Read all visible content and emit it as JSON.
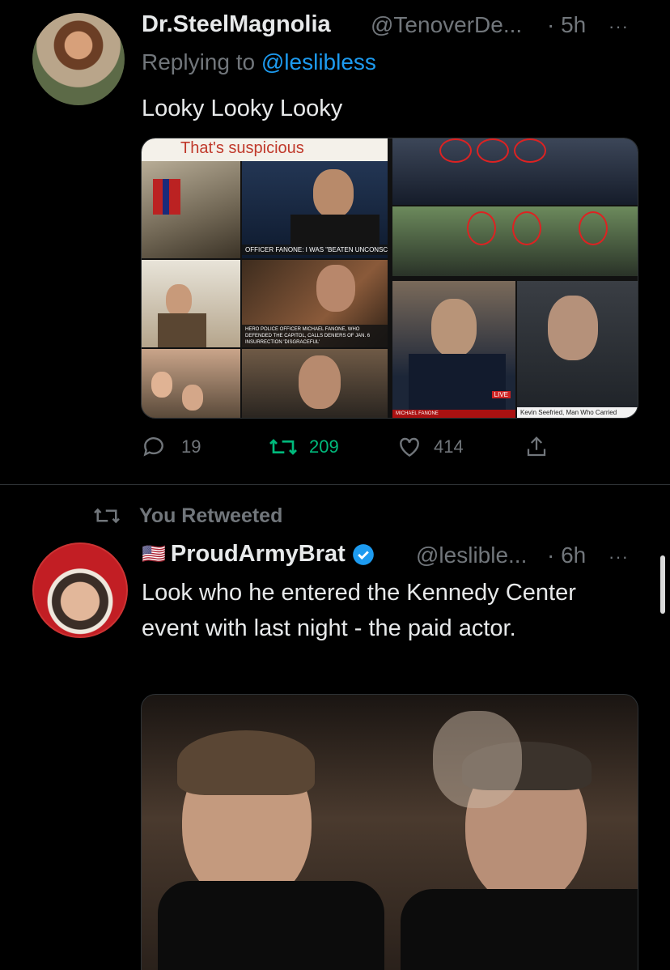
{
  "tweet1": {
    "display_name": "Dr.SteelMagnolia",
    "handle": "@TenoverDe...",
    "time": "· 5h",
    "more": "···",
    "replying_prefix": "Replying to ",
    "replying_handle": "@leslibless",
    "text": "Looky Looky Looky",
    "media": {
      "top_banner": "That's suspicious",
      "caption_1": "OFFICER FANONE: I WAS \"BEATEN UNCONSCIOUS\"",
      "caption_2": "HERO POLICE OFFICER MICHAEL FANONE, WHO DEFENDED THE CAPITOL, CALLS DENIERS OF JAN. 6 INSURRECTION 'DISGRACEFUL'",
      "caption_3": "MICHAEL FANONE",
      "caption_4": "Kevin Seefried, Man Who Carried",
      "live_badge": "LIVE"
    },
    "actions": {
      "reply_icon": "reply-icon",
      "reply_count": "19",
      "retweet_icon": "retweet-icon",
      "retweet_count": "209",
      "like_icon": "heart-icon",
      "like_count": "414",
      "share_icon": "share-icon"
    }
  },
  "tweet2": {
    "social_context": "You Retweeted",
    "flag": "🇺🇸",
    "display_name": "ProudArmyBrat",
    "verified_icon": "verified-badge-icon",
    "handle": "@leslible...",
    "time": "· 6h",
    "more": "···",
    "text": "Look who he entered the Kennedy Center event with last night - the paid actor."
  },
  "colors": {
    "background": "#000000",
    "text": "#e7e9ea",
    "muted": "#71767b",
    "link": "#1d9bf0",
    "retweeted_green": "#00ba7c",
    "divider": "#2f3336"
  }
}
